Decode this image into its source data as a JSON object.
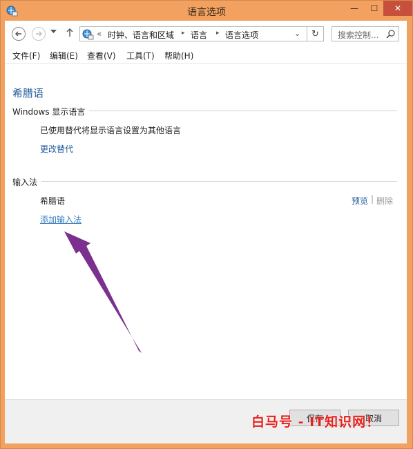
{
  "window": {
    "title": "语言选项",
    "min_glyph": "—",
    "max_glyph": "☐",
    "close_glyph": "✕"
  },
  "address": {
    "overflow": "«",
    "segments": [
      "时钟、语言和区域",
      "语言",
      "语言选项"
    ],
    "search_placeholder": "搜索控制..."
  },
  "menu": [
    "文件(F)",
    "编辑(E)",
    "查看(V)",
    "工具(T)",
    "帮助(H)"
  ],
  "content": {
    "language_title": "希腊语",
    "display_section": "Windows 显示语言",
    "display_status": "已使用替代将显示语言设置为其他语言",
    "change_override_link": "更改替代",
    "input_section": "输入法",
    "input_method_name": "希腊语",
    "preview_link": "预览",
    "separator": "|",
    "delete_link": "删除",
    "add_input_link": "添加输入法"
  },
  "footer": {
    "save_label": "保存",
    "cancel_label": "取消"
  },
  "watermark": "白马号 - IT知识网！",
  "colors": {
    "titlebar": "#f2a160",
    "link": "#1e5a9a",
    "arrow": "#7b2f8e",
    "watermark": "#e8211c"
  },
  "icons": [
    "app-icon",
    "back-arrow-icon",
    "forward-arrow-icon",
    "recent-pages-icon",
    "up-arrow-icon",
    "control-panel-icon",
    "dropdown-icon",
    "refresh-icon",
    "search-icon",
    "purple-arrow-annotation"
  ]
}
